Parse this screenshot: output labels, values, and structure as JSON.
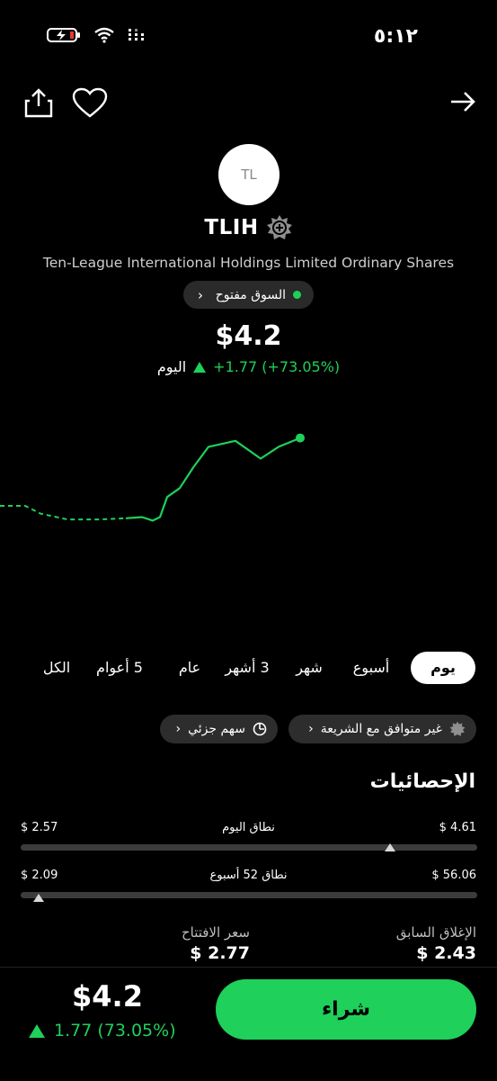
{
  "status_bar": {
    "time": "٥:١٢"
  },
  "stock": {
    "logo_text": "TL",
    "ticker": "TLIH",
    "company_name": "Ten-League International Holdings Limited Ordinary Shares",
    "market_status": "السوق مفتوح",
    "price": "$4.2",
    "change": "+1.77 (+73.05%)",
    "change_period": "اليوم"
  },
  "chart_data": {
    "type": "line",
    "series": [
      {
        "style": "dashed",
        "y": [
          3.05,
          3.05,
          2.92,
          2.82,
          2.82,
          2.84
        ]
      },
      {
        "style": "solid",
        "y": [
          2.84,
          2.86,
          2.8,
          2.86,
          3.2,
          3.35,
          3.7,
          4.05,
          4.15,
          3.85,
          4.05,
          4.2
        ]
      }
    ],
    "colors": {
      "line": "#1fd05a"
    }
  },
  "timeframes": {
    "tabs": [
      "يوم",
      "أسبوع",
      "شهر",
      "3 أشهر",
      "عام",
      "5 أعوام",
      "الكل"
    ],
    "active": "يوم"
  },
  "chips": {
    "sharia": "غير متوافق مع الشريعة",
    "fractional": "سهم جزئي"
  },
  "stats": {
    "title": "الإحصائيات",
    "day_range": {
      "label": "نطاق اليوم",
      "high": "$ 4.61",
      "low": "$ 2.57",
      "position": 0.81
    },
    "week52_range": {
      "label": "نطاق 52 أسبوع",
      "high": "$ 56.06",
      "low": "$ 2.09",
      "position": 0.04
    },
    "prev_close": {
      "label": "الإغلاق السابق",
      "value": "$ 2.43"
    },
    "open": {
      "label": "سعر الافتتاح",
      "value": "$ 2.77"
    }
  },
  "bottom_bar": {
    "price": "$4.2",
    "change": "1.77 (73.05%)",
    "buy_label": "شراء"
  },
  "colors": {
    "accent": "#1fd05a",
    "background": "#000000",
    "chip": "#2d2d2d"
  }
}
